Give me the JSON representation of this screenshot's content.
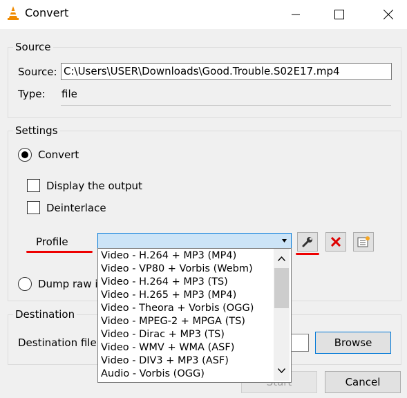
{
  "window": {
    "title": "Convert"
  },
  "source": {
    "group_label": "Source",
    "source_label": "Source:",
    "source_value": "C:\\Users\\USER\\Downloads\\Good.Trouble.S02E17.mp4",
    "type_label": "Type:",
    "type_value": "file"
  },
  "settings": {
    "group_label": "Settings",
    "convert_label": "Convert",
    "display_output_label": "Display the output",
    "deinterlace_label": "Deinterlace",
    "profile_label": "Profile",
    "dump_raw_label": "Dump raw in",
    "profiles": [
      "Video - H.264 + MP3 (MP4)",
      "Video - VP80 + Vorbis (Webm)",
      "Video - H.264 + MP3 (TS)",
      "Video - H.265 + MP3 (MP4)",
      "Video - Theora + Vorbis (OGG)",
      "Video - MPEG-2 + MPGA (TS)",
      "Video - Dirac + MP3 (TS)",
      "Video - WMV + WMA (ASF)",
      "Video - DIV3 + MP3 (ASF)",
      "Audio - Vorbis (OGG)"
    ]
  },
  "destination": {
    "group_label": "Destination",
    "file_label": "Destination file:",
    "browse_label": "Browse"
  },
  "footer": {
    "start_label": "Start",
    "cancel_label": "Cancel"
  },
  "colors": {
    "annotation_red": "#e00000",
    "selection_blue": "#cce4f7",
    "accent": "#0078d7"
  }
}
